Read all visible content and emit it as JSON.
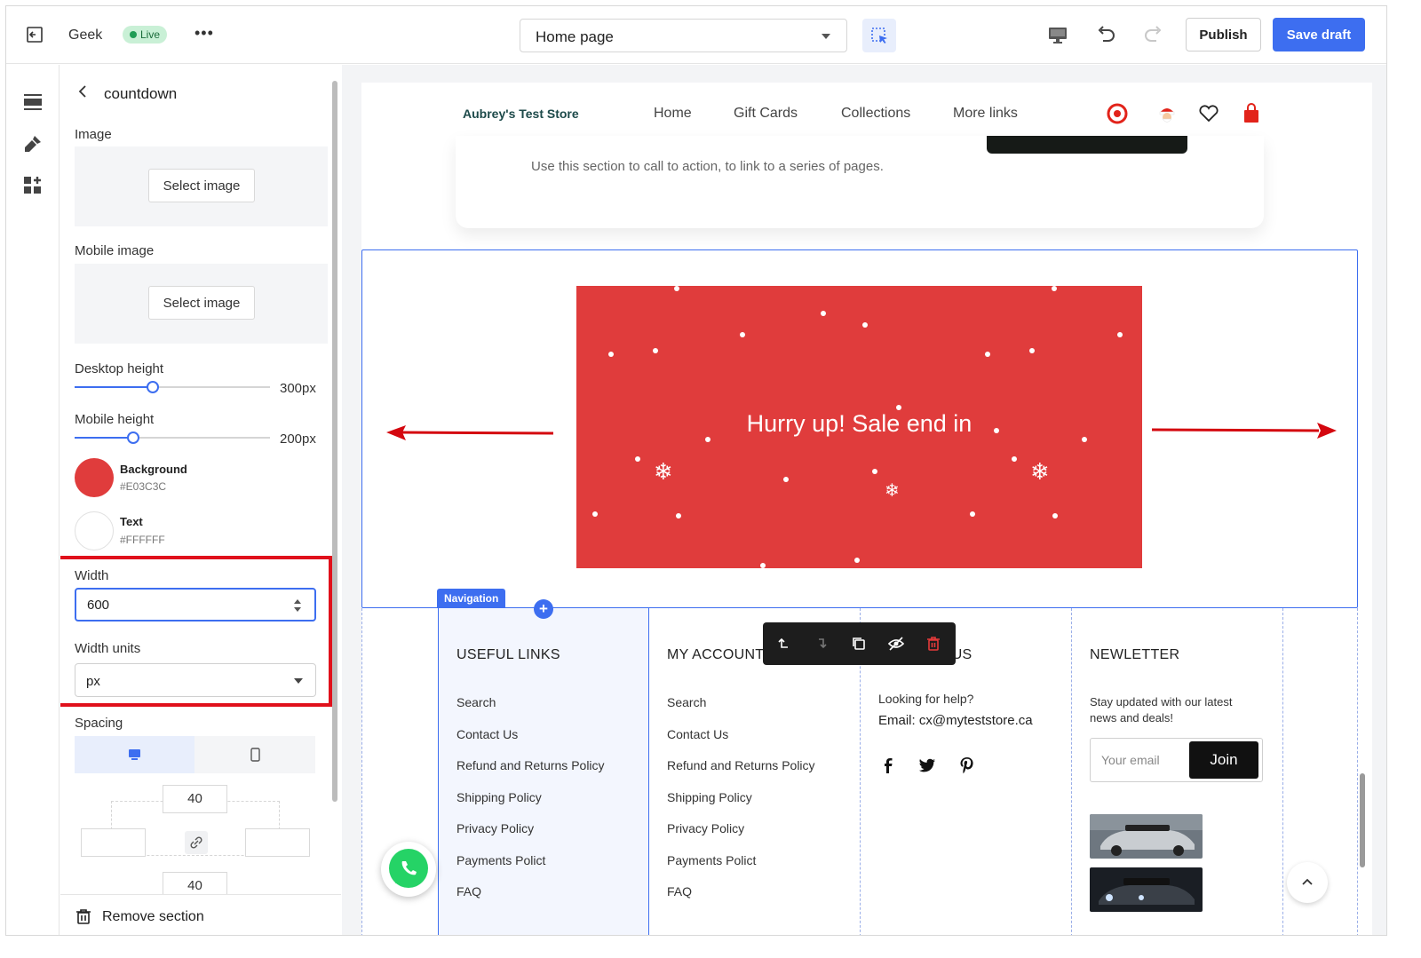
{
  "topbar": {
    "store_name": "Geek",
    "status": "Live",
    "more": "•••",
    "page_select": "Home page",
    "publish": "Publish",
    "save_draft": "Save draft"
  },
  "rail": {
    "icons": [
      "sections-icon",
      "theme-settings-icon",
      "apps-icon"
    ]
  },
  "panel": {
    "title": "countdown",
    "image_label": "Image",
    "select_image": "Select image",
    "mobile_image_label": "Mobile image",
    "select_mobile_image": "Select image",
    "desktop_height_label": "Desktop height",
    "desktop_height_value": "300px",
    "desktop_height_fraction": 0.4,
    "mobile_height_label": "Mobile height",
    "mobile_height_value": "200px",
    "mobile_height_fraction": 0.3,
    "background_label": "Background",
    "background_hex": "#E03C3C",
    "text_label": "Text",
    "text_hex": "#FFFFFF",
    "width_label": "Width",
    "width_value": "600",
    "width_units_label": "Width units",
    "width_units_value": "px",
    "spacing_label": "Spacing",
    "spacing_top": "40",
    "spacing_bottom": "40",
    "spacing_left": "",
    "spacing_right": "",
    "remove_section": "Remove section"
  },
  "store": {
    "logo": "Aubrey's Test Store",
    "nav": [
      "Home",
      "Gift Cards",
      "Collections",
      "More links"
    ],
    "banner_text": "Use this section to call to action, to link to a series of pages.",
    "countdown_headline": "Hurry up! Sale end in",
    "navigation_badge": "Navigation",
    "footer": {
      "useful_links_title": "USEFUL LINKS",
      "useful_links": [
        "Search",
        "Contact Us",
        "Refund and Returns Policy",
        "Shipping Policy",
        "Privacy Policy",
        "Payments Polict",
        "FAQ"
      ],
      "my_account_title": "MY ACCOUNT",
      "my_account": [
        "Search",
        "Contact Us",
        "Refund and Returns Policy",
        "Shipping Policy",
        "Privacy Policy",
        "Payments Polict",
        "FAQ"
      ],
      "contact_title": "CONTACT US",
      "contact_help": "Looking for help?",
      "contact_email": "Email:  cx@myteststore.ca",
      "newsletter_title": "NEWLETTER",
      "newsletter_text_1": "Stay updated with our latest",
      "newsletter_text_2": "news and deals!",
      "email_placeholder": "Your email",
      "join": "Join"
    }
  },
  "colors": {
    "accent": "#3d6ef0",
    "countdown_bg": "#E03C3C",
    "highlight": "#e0101b"
  }
}
